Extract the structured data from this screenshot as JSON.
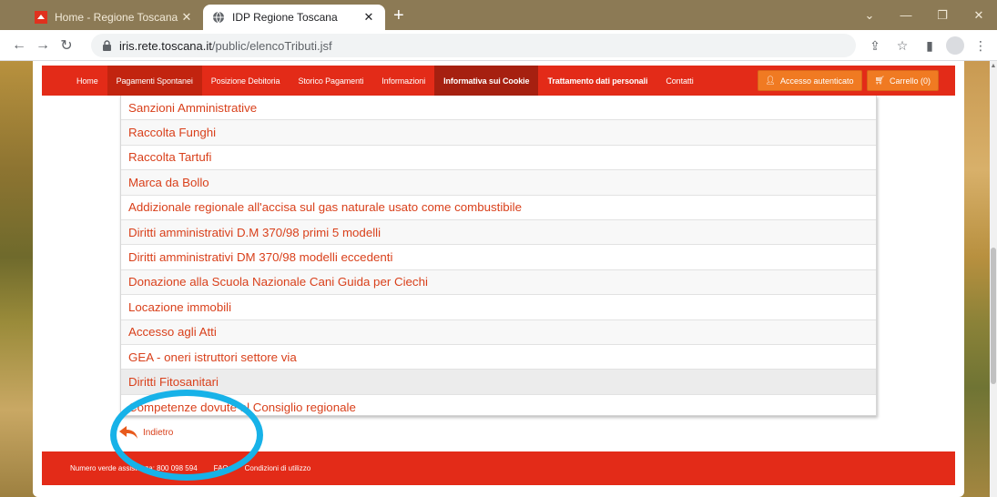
{
  "browser": {
    "tabs": [
      {
        "title": "Home - Regione Toscana",
        "active": false
      },
      {
        "title": "IDP Regione Toscana",
        "active": true
      }
    ],
    "address": {
      "domain": "iris.rete.toscana.it",
      "path": "/public/elencoTributi.jsf"
    }
  },
  "navbar": {
    "items": [
      {
        "label": "Home"
      },
      {
        "label": "Pagamenti Spontanei"
      },
      {
        "label": "Posizione Debitoria"
      },
      {
        "label": "Storico Pagamenti"
      },
      {
        "label": "Informazioni"
      },
      {
        "label": "Informativa sui Cookie"
      },
      {
        "label": "Trattamento dati personali"
      },
      {
        "label": "Contatti"
      }
    ],
    "login_label": "Accesso autenticato",
    "cart_label": "Carrello (0)"
  },
  "tributi": [
    "Sanzioni Amministrative",
    "Raccolta Funghi",
    "Raccolta Tartufi",
    "Marca da Bollo",
    "Addizionale regionale all'accisa sul gas naturale usato come combustibile",
    "Diritti amministrativi D.M 370/98 primi 5 modelli",
    "Diritti amministrativi DM 370/98 modelli eccedenti",
    "Donazione alla Scuola Nazionale Cani Guida per Ciechi",
    "Locazione immobili",
    "Accesso agli Atti",
    "GEA - oneri istruttori settore via",
    "Diritti Fitosanitari",
    "Competenze dovute al Consiglio regionale"
  ],
  "back_label": "Indietro",
  "footer": {
    "numero_verde": "Numero verde assistenza: 800 098 594",
    "faq": "FAQ",
    "condizioni": "Condizioni di utilizzo"
  },
  "colors": {
    "brand_red": "#e32b18",
    "link": "#d9401b",
    "annotation": "#17b2e8",
    "button_orange": "#f07a22"
  }
}
